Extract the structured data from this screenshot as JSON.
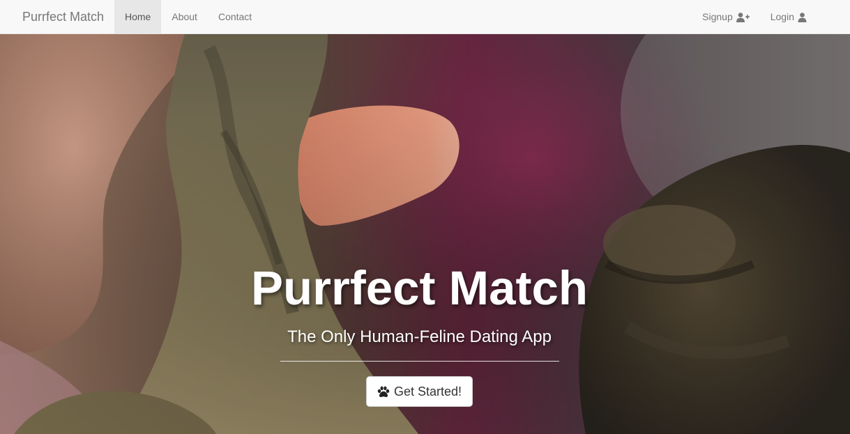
{
  "navbar": {
    "brand": "Purrfect Match",
    "links": [
      {
        "label": "Home",
        "active": true
      },
      {
        "label": "About",
        "active": false
      },
      {
        "label": "Contact",
        "active": false
      }
    ],
    "right_links": [
      {
        "label": "Signup",
        "icon": "user-plus-icon"
      },
      {
        "label": "Login",
        "icon": "user-icon"
      }
    ]
  },
  "hero": {
    "title": "Purrfect Match",
    "subtitle": "The Only Human-Feline Dating App",
    "cta_label": "Get Started!",
    "cta_icon": "paw-icon",
    "background": "photo of a human finger touching a cat's paw, with a cat's head on the right"
  },
  "colors": {
    "navbar_bg": "#f8f8f8",
    "navbar_text": "#777777",
    "active_tab_bg": "#e7e7e7",
    "hero_text": "#ffffff",
    "button_bg": "#ffffff"
  }
}
